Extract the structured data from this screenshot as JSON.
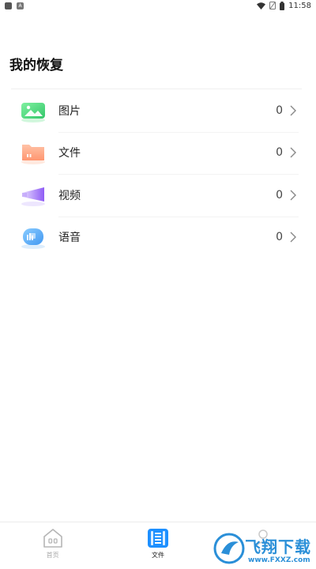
{
  "status_bar": {
    "time": "11:58",
    "icons": [
      "app-icon",
      "a-badge-icon",
      "wifi-icon",
      "no-sim-icon",
      "battery-icon"
    ]
  },
  "page": {
    "title": "我的恢复"
  },
  "items": [
    {
      "label": "图片",
      "count": "0",
      "icon": "image-icon",
      "color": "#4cd97a"
    },
    {
      "label": "文件",
      "count": "0",
      "icon": "folder-icon",
      "color": "#ff9a72"
    },
    {
      "label": "视频",
      "count": "0",
      "icon": "video-icon",
      "color": "#9b6cf5"
    },
    {
      "label": "语音",
      "count": "0",
      "icon": "audio-icon",
      "color": "#3aa0f5"
    }
  ],
  "tab_bar": {
    "tabs": [
      {
        "label": "首页",
        "icon": "home-icon",
        "active": false
      },
      {
        "label": "文件",
        "icon": "document-icon",
        "active": true
      },
      {
        "label": "",
        "icon": "user-icon",
        "active": false
      }
    ],
    "accent": "#1e90ff"
  },
  "watermark": {
    "text": "飞翔下载",
    "url": "www.FXXZ.com"
  }
}
